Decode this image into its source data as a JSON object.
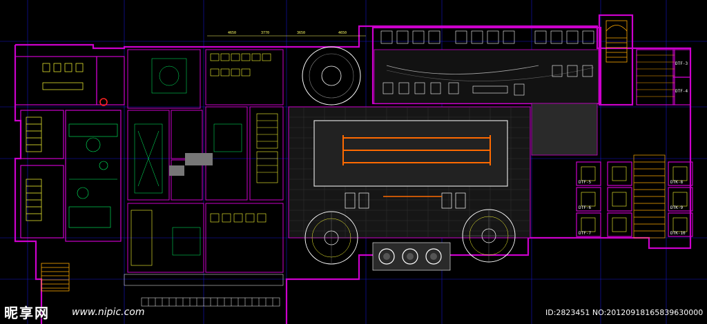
{
  "colors": {
    "background": "#000000",
    "wall": "#cc00cc",
    "grid": "#1a1aff",
    "fixture": "#ffff33",
    "detail": "#00ff66",
    "text": "#ffffff",
    "pool_lane": "#ff6a00",
    "stair": "#ffaa00",
    "accent_red": "#ff2222"
  },
  "watermark": {
    "logo": "昵享网",
    "url": "www.nipic.com",
    "id_line": "ID:2823451 NO:20120918165839630000"
  },
  "dimensions_top": [
    "4650",
    "3770",
    "3650",
    "4650"
  ],
  "room_labels": {
    "left_column": [
      "DTF-5",
      "DTF-6",
      "DTF-7"
    ],
    "right_column": [
      "DTK-8",
      "DTK-9",
      "DTK-10"
    ],
    "upper_right": [
      "DTF-3",
      "DTF-4"
    ],
    "lower_mid": [
      "DTF-5",
      "DTF-6",
      "DTF-7"
    ]
  }
}
